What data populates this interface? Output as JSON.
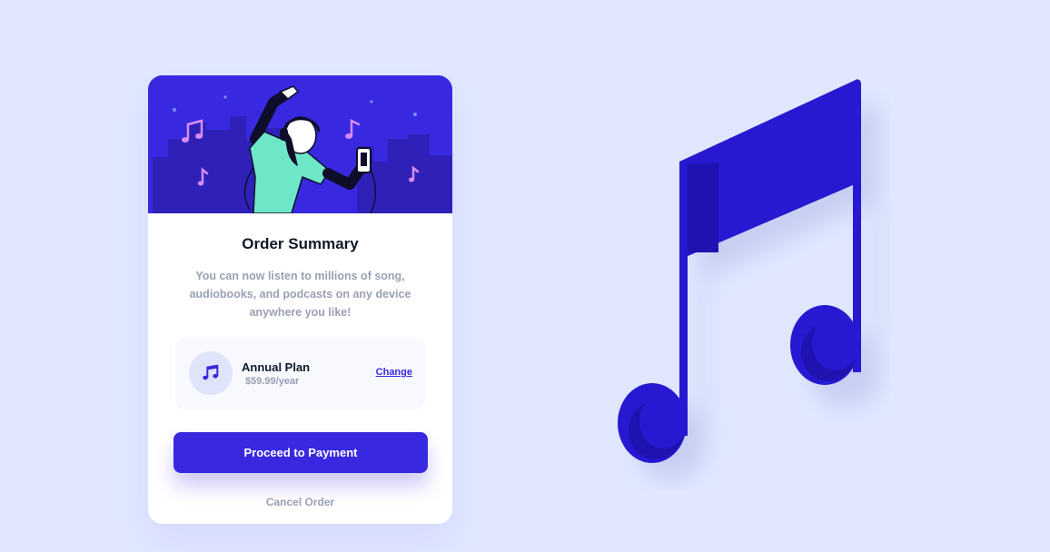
{
  "card": {
    "title": "Order Summary",
    "description": "You can now listen to millions of song, audiobooks, and podcasts on any device anywhere you like!",
    "plan": {
      "icon": "music-note-icon",
      "name": "Annual Plan",
      "price": "$59.99/year",
      "change_label": "Change"
    },
    "proceed_label": "Proceed to Payment",
    "cancel_label": "Cancel Order"
  },
  "colors": {
    "background": "#e0e7ff",
    "accent": "#3829e0",
    "hero_background": "#3829e0",
    "dancer_shirt": "#6ee7c8",
    "note_pink": "#d58cf5",
    "muted_text": "#9aa0b4",
    "title_text": "#111827"
  },
  "icons": {
    "hero_illustration": "person-dancing-with-headphones-illustration",
    "background_decoration": "large-music-note-icon"
  }
}
